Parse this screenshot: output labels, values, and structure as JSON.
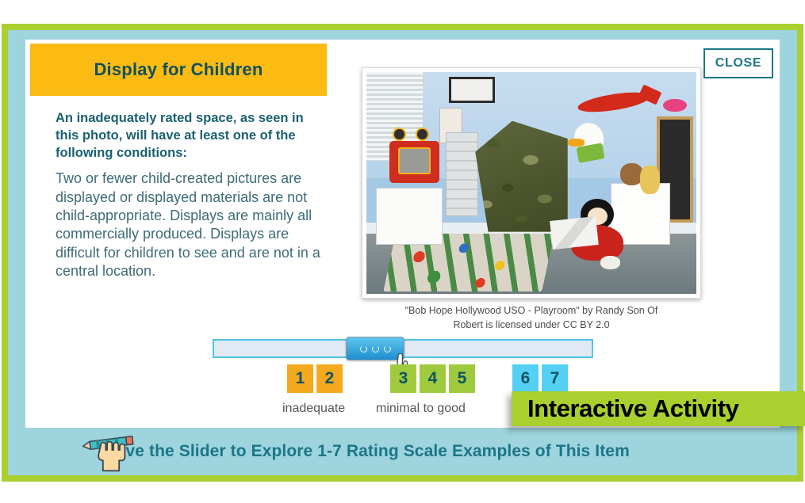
{
  "window": {
    "accent_green": "#a9d02f",
    "panel_blue": "#9ed4de",
    "title_bar_yellow": "#fbbb13",
    "teal_text": "#1b7687"
  },
  "card": {
    "title": "Display for Children",
    "close_label": "CLOSE",
    "lead_text": "An inadequately rated space, as seen in this photo, will have at least one of the following conditions:",
    "body_text": "Two or fewer child-created pictures are displayed or displayed materials are not child-appropriate. Displays are mainly all commercially produced. Displays are difficult for children to see and are not in a central location."
  },
  "photo": {
    "alt": "playroom-photo",
    "caption_line1": "\"Bob Hope Hollywood USO - Playroom\" by Randy Son Of",
    "caption_line2": "Robert is licensed under CC BY 2.0"
  },
  "slider": {
    "name": "rating-slider",
    "handle_icon": "grip-dots",
    "cursor_icon": "pointing-hand-cursor"
  },
  "scale": {
    "groups": [
      {
        "color": "orange",
        "hex": "#f5a91f",
        "chips": [
          "1",
          "2"
        ],
        "label": "inadequate"
      },
      {
        "color": "green",
        "hex": "#9fca3e",
        "chips": [
          "3",
          "4",
          "5"
        ],
        "label": "minimal to good"
      },
      {
        "color": "cyan",
        "hex": "#55d0f5",
        "chips": [
          "6",
          "7"
        ],
        "label": ""
      }
    ]
  },
  "badge": {
    "text": "Interactive Activity"
  },
  "footer": {
    "icon": "hand-with-pencil-icon",
    "text": "Move the Slider to Explore 1-7 Rating Scale Examples of This Item"
  }
}
